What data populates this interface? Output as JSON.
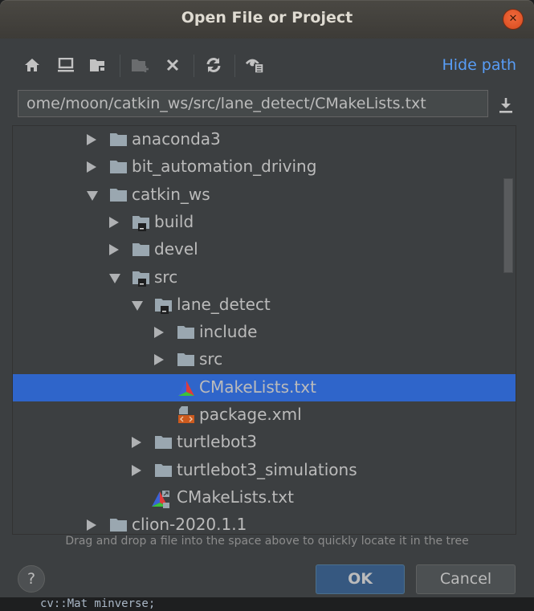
{
  "dialog": {
    "title": "Open File or Project",
    "close_icon": "close-icon"
  },
  "toolbar": {
    "buttons": [
      {
        "name": "home-button",
        "icon": "home-icon",
        "enabled": true
      },
      {
        "name": "desktop-button",
        "icon": "desktop-icon",
        "enabled": true
      },
      {
        "name": "project-directory-button",
        "icon": "project-folder-icon",
        "enabled": true
      },
      {
        "name": "new-folder-button",
        "icon": "new-folder-icon",
        "enabled": false
      },
      {
        "name": "delete-button",
        "icon": "delete-x-icon",
        "enabled": true
      },
      {
        "name": "refresh-button",
        "icon": "refresh-icon",
        "enabled": true
      },
      {
        "name": "show-hidden-files-button",
        "icon": "show-hidden-icon",
        "enabled": true
      }
    ],
    "hide_path_label": "Hide path"
  },
  "path": {
    "value": "ome/moon/catkin_ws/src/lane_detect/CMakeLists.txt",
    "download_icon": "download-icon"
  },
  "tree": {
    "items": [
      {
        "label": "anaconda3",
        "depth": 0,
        "expander": "collapsed",
        "icon": "folder"
      },
      {
        "label": "bit_automation_driving",
        "depth": 0,
        "expander": "collapsed",
        "icon": "folder"
      },
      {
        "label": "catkin_ws",
        "depth": 0,
        "expander": "expanded",
        "icon": "folder"
      },
      {
        "label": "build",
        "depth": 1,
        "expander": "collapsed",
        "icon": "module-folder"
      },
      {
        "label": "devel",
        "depth": 1,
        "expander": "collapsed",
        "icon": "folder"
      },
      {
        "label": "src",
        "depth": 1,
        "expander": "expanded",
        "icon": "module-folder"
      },
      {
        "label": "lane_detect",
        "depth": 2,
        "expander": "expanded",
        "icon": "module-folder"
      },
      {
        "label": "include",
        "depth": 3,
        "expander": "collapsed",
        "icon": "folder"
      },
      {
        "label": "src",
        "depth": 3,
        "expander": "collapsed",
        "icon": "folder"
      },
      {
        "label": "CMakeLists.txt",
        "depth": 3,
        "expander": "none",
        "icon": "cmake",
        "selected": true
      },
      {
        "label": "package.xml",
        "depth": 3,
        "expander": "none",
        "icon": "xml"
      },
      {
        "label": "turtlebot3",
        "depth": 2,
        "expander": "collapsed",
        "icon": "folder"
      },
      {
        "label": "turtlebot3_simulations",
        "depth": 2,
        "expander": "collapsed",
        "icon": "folder"
      },
      {
        "label": "CMakeLists.txt",
        "depth": 2,
        "expander": "none",
        "icon": "cmake-link"
      },
      {
        "label": "clion-2020.1.1",
        "depth": 0,
        "expander": "collapsed",
        "icon": "folder"
      }
    ]
  },
  "hint": "Drag and drop a file into the space above to quickly locate it in the tree",
  "buttons": {
    "help_label": "?",
    "ok_label": "OK",
    "cancel_label": "Cancel"
  },
  "background": {
    "code_fragment": "cv::Mat minverse;"
  },
  "colors": {
    "selection": "#2f65ca",
    "link": "#589df6",
    "ok_button": "#365880",
    "close_button": "#e8582a"
  }
}
